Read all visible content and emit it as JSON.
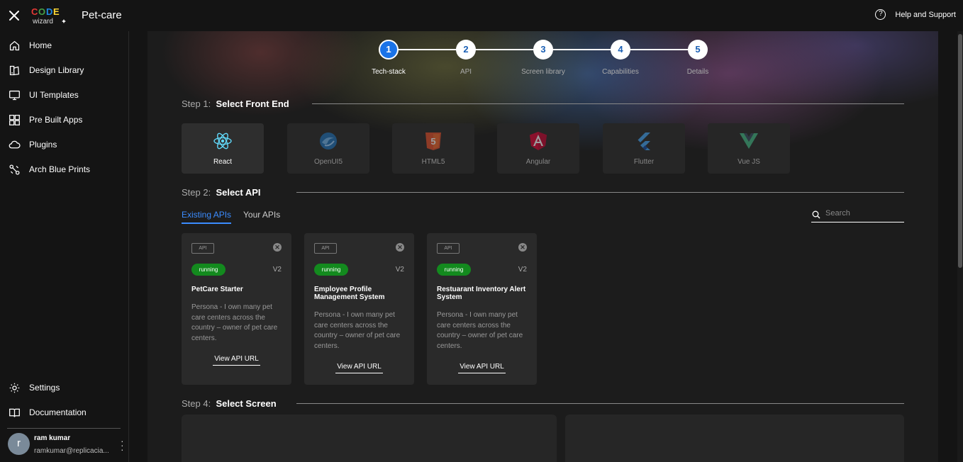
{
  "header": {
    "app_title": "Pet-care",
    "help_label": "Help and Support",
    "logo_text": "CODE wizard"
  },
  "sidebar": {
    "items": [
      {
        "label": "Home",
        "icon": "home-icon"
      },
      {
        "label": "Design Library",
        "icon": "design-library-icon"
      },
      {
        "label": "UI Templates",
        "icon": "monitor-icon"
      },
      {
        "label": "Pre Built Apps",
        "icon": "apps-icon"
      },
      {
        "label": "Plugins",
        "icon": "cloud-icon"
      },
      {
        "label": "Arch Blue Prints",
        "icon": "blueprint-icon"
      }
    ],
    "bottom_items": [
      {
        "label": "Settings",
        "icon": "gear-icon"
      },
      {
        "label": "Documentation",
        "icon": "book-icon"
      }
    ],
    "user": {
      "initial": "r",
      "name": "ram kumar",
      "email": "ramkumar@replicacia..."
    }
  },
  "stepper": {
    "steps": [
      {
        "number": "1",
        "label": "Tech-stack",
        "active": true
      },
      {
        "number": "2",
        "label": "API",
        "active": false
      },
      {
        "number": "3",
        "label": "Screen library",
        "active": false
      },
      {
        "number": "4",
        "label": "Capabilities",
        "active": false
      },
      {
        "number": "5",
        "label": "Details",
        "active": false
      }
    ]
  },
  "step1": {
    "prefix": "Step 1:",
    "title": "Select Front End",
    "frontends": [
      {
        "name": "React",
        "icon": "react-icon",
        "selected": true
      },
      {
        "name": "OpenUI5",
        "icon": "openui5-icon",
        "selected": false
      },
      {
        "name": "HTML5",
        "icon": "html5-icon",
        "selected": false
      },
      {
        "name": "Angular",
        "icon": "angular-icon",
        "selected": false
      },
      {
        "name": "Flutter",
        "icon": "flutter-icon",
        "selected": false
      },
      {
        "name": "Vue JS",
        "icon": "vue-icon",
        "selected": false
      }
    ]
  },
  "step2": {
    "prefix": "Step 2:",
    "title": "Select API",
    "tabs": [
      {
        "label": "Existing APIs",
        "active": true
      },
      {
        "label": "Your APIs",
        "active": false
      }
    ],
    "search_placeholder": "Search",
    "apis": [
      {
        "badge": "API",
        "status": "running",
        "version": "V2",
        "name": "PetCare Starter",
        "description": "Persona - I own many pet care centers across the country – owner of pet care centers.",
        "link": "View API URL"
      },
      {
        "badge": "API",
        "status": "running",
        "version": "V2",
        "name": "Employee Profile Management System",
        "description": "Persona - I own many pet care centers across the country – owner of pet care centers.",
        "link": "View API URL"
      },
      {
        "badge": "API",
        "status": "running",
        "version": "V2",
        "name": "Restuarant Inventory Alert System",
        "description": "Persona - I own many pet care centers across the country – owner of pet care centers.",
        "link": "View API URL"
      }
    ]
  },
  "step4": {
    "prefix": "Step 4:",
    "title": "Select Screen"
  },
  "colors": {
    "accent": "#1a73e8",
    "running": "#138a1e",
    "background": "#1c1c1c"
  }
}
